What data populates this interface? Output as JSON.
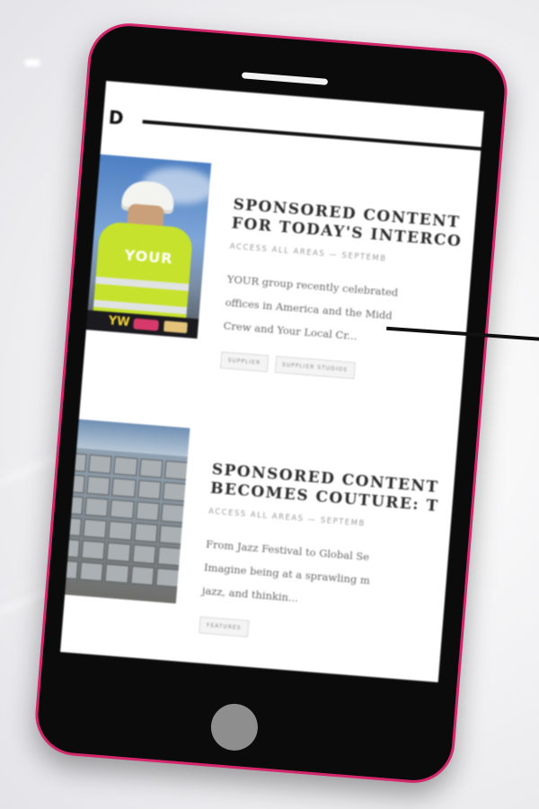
{
  "header": {
    "logo_text": "D"
  },
  "articles": [
    {
      "title_line1": "SPONSORED CONTENT",
      "title_line2": "FOR TODAY'S INTERCO",
      "meta": "ACCESS ALL AREAS — SEPTEMB",
      "excerpt_line1": "YOUR group recently celebrated",
      "excerpt_line2": "offices in America and the Midd",
      "excerpt_line3": "Crew and Your Local Cr...",
      "tags": [
        "SUPPLIER",
        "SUPPLIER STUDIOS"
      ],
      "thumbnail": {
        "vest_text": "YOUR",
        "logo_text": "YW"
      }
    },
    {
      "title_line1": "SPONSORED CONTENT",
      "title_line2": "BECOMES COUTURE: T",
      "meta": "ACCESS ALL AREAS — SEPTEMB",
      "excerpt_line1": "From Jazz Festival to Global Se",
      "excerpt_line2": "Imagine being at a sprawling m",
      "excerpt_line3": "jazz, and thinkin...",
      "tags": [
        "FEATURES"
      ]
    }
  ],
  "colors": {
    "phone_body": "#0b0b0b",
    "phone_accent_border": "#d4266b",
    "screen_background": "#ffffff",
    "home_button": "#8e8e8e"
  }
}
